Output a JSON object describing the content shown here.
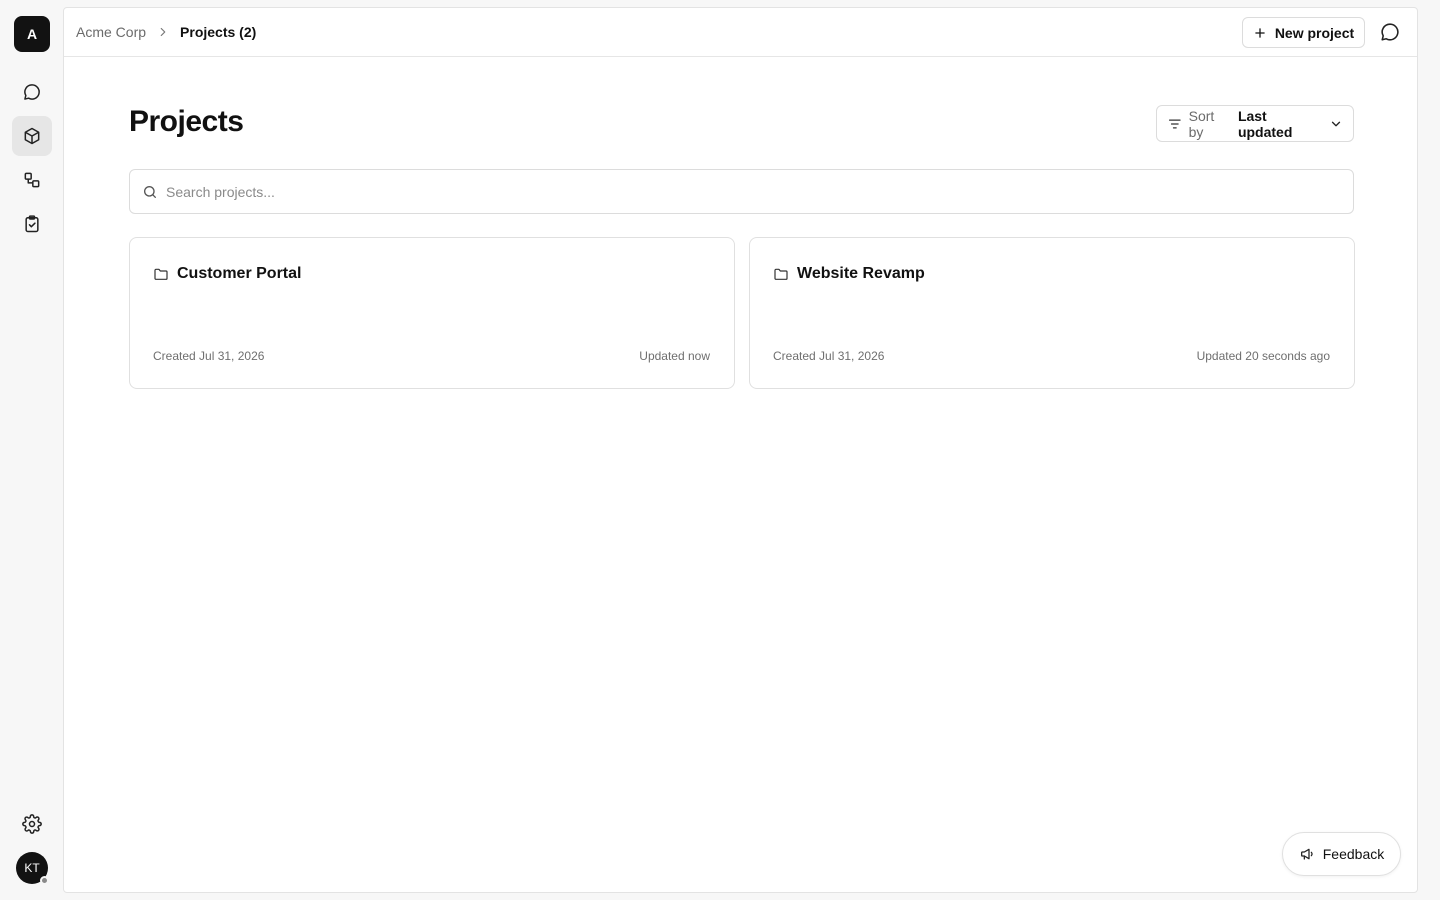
{
  "workspace": {
    "initial": "A"
  },
  "rail": {
    "items": [
      {
        "name": "chat-icon",
        "active": false
      },
      {
        "name": "cube-icon",
        "active": true
      },
      {
        "name": "workflow-icon",
        "active": false
      },
      {
        "name": "clipboard-check-icon",
        "active": false
      }
    ],
    "settings_icon": "gear-icon",
    "user": {
      "initials": "KT",
      "status_color": "#8a8a8a"
    }
  },
  "header": {
    "breadcrumb_root": "Acme Corp",
    "breadcrumb_current": "Projects (2)",
    "new_project_label": "New project",
    "chat_icon": "chat-bubble-icon"
  },
  "main": {
    "title": "Projects",
    "sort": {
      "label": "Sort by",
      "value": "Last updated"
    },
    "search": {
      "placeholder": "Search projects...",
      "value": ""
    },
    "projects": [
      {
        "name": "Customer Portal",
        "created": "Created Jul 31, 2026",
        "updated": "Updated now"
      },
      {
        "name": "Website Revamp",
        "created": "Created Jul 31, 2026",
        "updated": "Updated 20 seconds ago"
      }
    ]
  },
  "feedback": {
    "label": "Feedback"
  },
  "colors": {
    "accent": "#121212",
    "border": "#e0e0e0",
    "muted_text": "#6b6b6b",
    "background": "#f7f7f7"
  }
}
